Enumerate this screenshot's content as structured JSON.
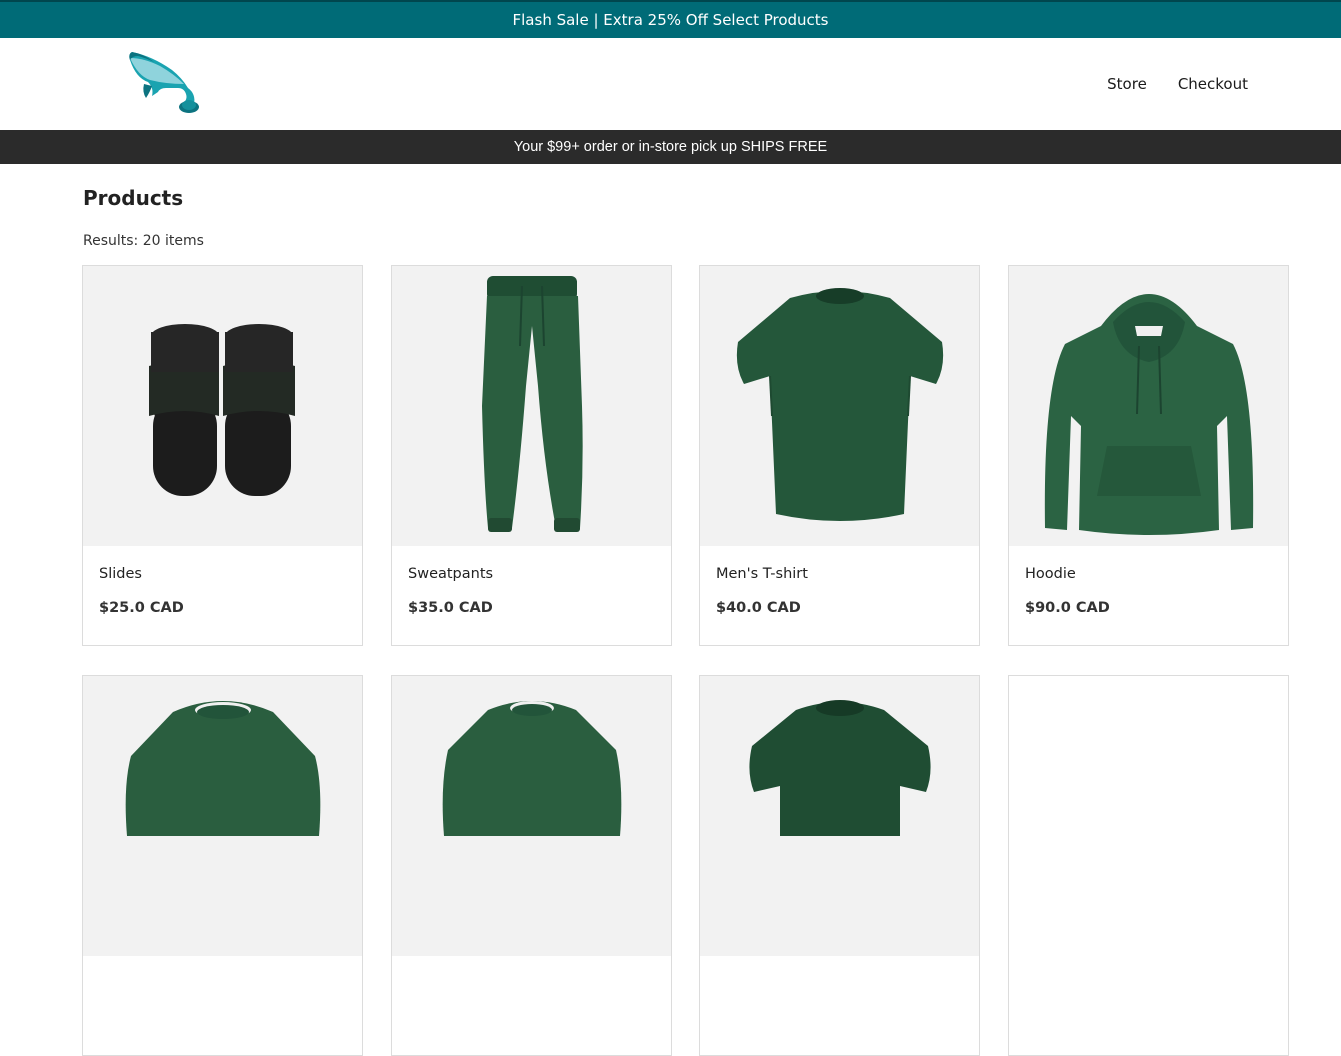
{
  "promo": {
    "text": "Flash Sale | Extra 25% Off Select Products"
  },
  "header": {
    "logo_icon": "whale-logo-icon",
    "nav": [
      {
        "label": "Store"
      },
      {
        "label": "Checkout"
      }
    ]
  },
  "shipping": {
    "text": "Your $99+ order or in-store pick up SHIPS FREE"
  },
  "page": {
    "title": "Products",
    "results": "Results: 20 items"
  },
  "colors": {
    "brand_teal": "#006b77",
    "dark_bar": "#2b2b2b",
    "product_green": "#24573a",
    "image_bg": "#f2f2f2"
  },
  "products": [
    {
      "name": "Slides",
      "price": "$25.0 CAD",
      "image_icon": "slides-image"
    },
    {
      "name": "Sweatpants",
      "price": "$35.0 CAD",
      "image_icon": "sweatpants-image"
    },
    {
      "name": "Men's T-shirt",
      "price": "$40.0 CAD",
      "image_icon": "tshirt-image"
    },
    {
      "name": "Hoodie",
      "price": "$90.0 CAD",
      "image_icon": "hoodie-image"
    },
    {
      "name": "",
      "price": "",
      "image_icon": "sweatshirt-image"
    },
    {
      "name": "",
      "price": "",
      "image_icon": "sweatshirt-image"
    },
    {
      "name": "",
      "price": "",
      "image_icon": "tshirt-image"
    },
    {
      "name": "",
      "price": "",
      "image_icon": ""
    }
  ]
}
